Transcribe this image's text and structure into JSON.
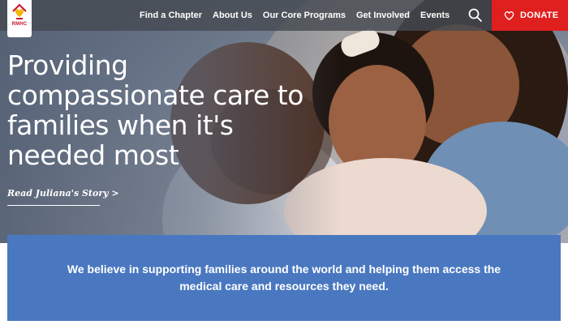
{
  "brand": {
    "logo_text": "RMHC",
    "accent_color": "#e01f1f",
    "mission_color": "#4a78c0"
  },
  "nav": {
    "items": [
      {
        "label": "Find a Chapter"
      },
      {
        "label": "About Us"
      },
      {
        "label": "Our Core Programs"
      },
      {
        "label": "Get Involved"
      },
      {
        "label": "Events"
      }
    ],
    "search_icon": "search-icon",
    "donate_label": "DONATE",
    "donate_icon": "heart-icon"
  },
  "hero": {
    "headline": "Providing compassionate care to families when it's needed most",
    "story_link": "Read Juliana's Story >"
  },
  "mission": {
    "text": "We believe in supporting families around the world and helping them access the medical care and resources they need."
  }
}
